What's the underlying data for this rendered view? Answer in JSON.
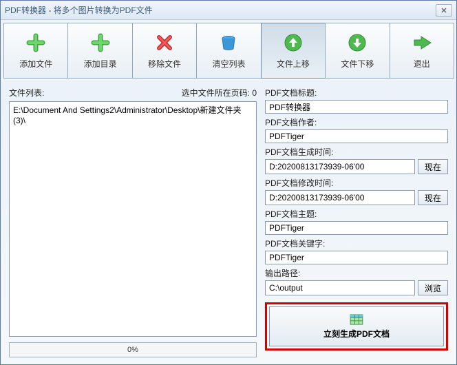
{
  "window": {
    "title": "PDF转换器 - 将多个图片转换为PDF文件"
  },
  "toolbar": {
    "add_file": "添加文件",
    "add_dir": "添加目录",
    "remove": "移除文件",
    "clear": "清空列表",
    "move_up": "文件上移",
    "move_down": "文件下移",
    "exit": "退出"
  },
  "left": {
    "list_label": "文件列表:",
    "page_status": "选中文件所在页码: 0",
    "file_item": "E:\\Document And Settings2\\Administrator\\Desktop\\新建文件夹 (3)\\",
    "progress": "0%"
  },
  "fields": {
    "title_label": "PDF文档标题:",
    "title_value": "PDF转换器",
    "author_label": "PDF文档作者:",
    "author_value": "PDFTiger",
    "create_label": "PDF文档生成时间:",
    "create_value": "D:20200813173939-06'00",
    "modify_label": "PDF文档修改时间:",
    "modify_value": "D:20200813173939-06'00",
    "subject_label": "PDF文档主题:",
    "subject_value": "PDFTiger",
    "keywords_label": "PDF文档关键字:",
    "keywords_value": "PDFTiger",
    "output_label": "输出路径:",
    "output_value": "C:\\output",
    "now_btn": "现在",
    "browse_btn": "浏览"
  },
  "generate": {
    "label": "立刻生成PDF文档"
  }
}
